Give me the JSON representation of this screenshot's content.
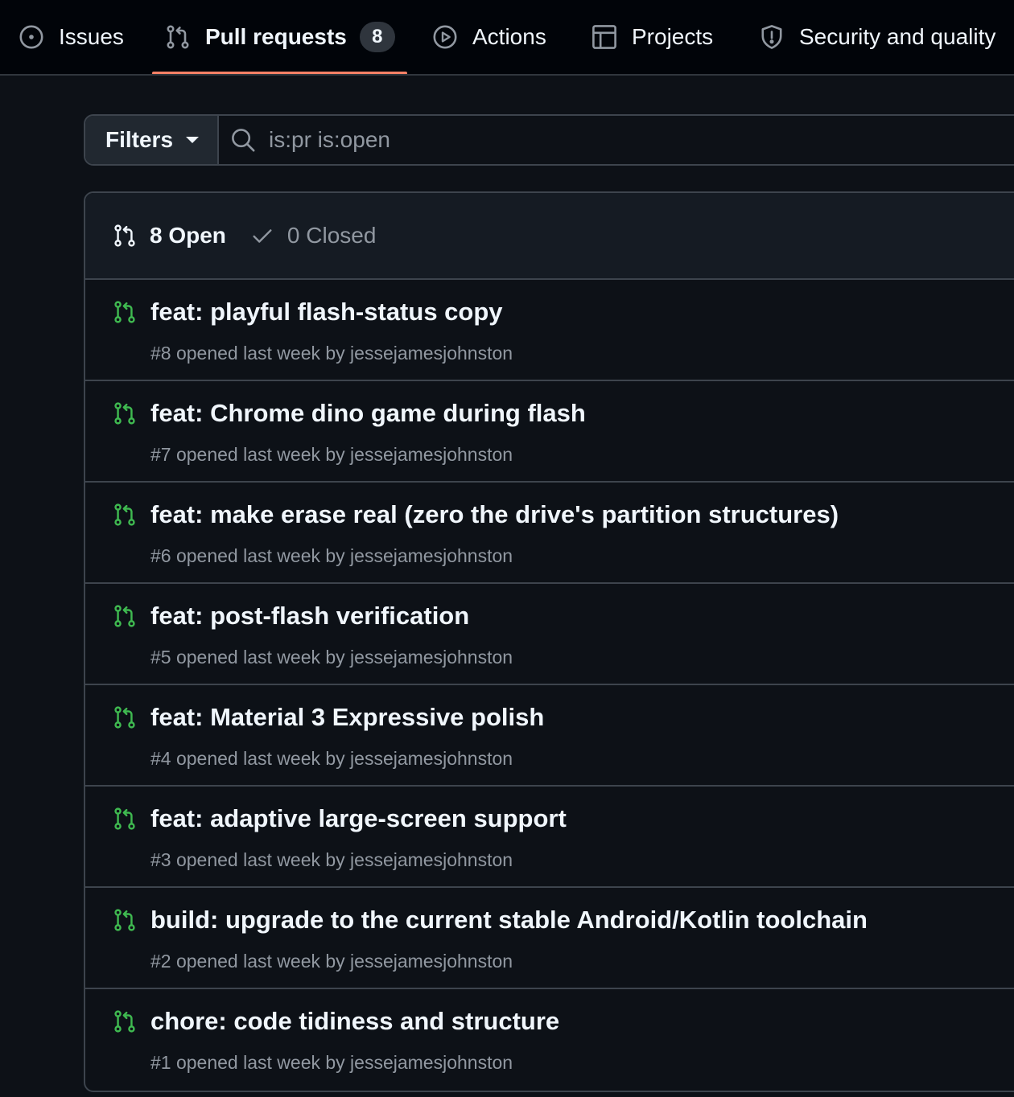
{
  "nav": {
    "tabs": [
      {
        "label": "Issues",
        "icon": "issue-opened-icon"
      },
      {
        "label": "Pull requests",
        "icon": "git-pull-request-icon",
        "counter": "8",
        "active": true
      },
      {
        "label": "Actions",
        "icon": "play-icon"
      },
      {
        "label": "Projects",
        "icon": "table-icon"
      },
      {
        "label": "Security and quality",
        "icon": "shield-icon"
      }
    ],
    "active_underline_color": "#f78166"
  },
  "filter_bar": {
    "filters_label": "Filters",
    "search_value": "is:pr is:open"
  },
  "pr_list": {
    "open_label": "8 Open",
    "closed_label": "0 Closed",
    "open_icon_color": "#3fb950",
    "items": [
      {
        "title": "feat: playful flash-status copy",
        "meta": "#8 opened last week by jessejamesjohnston"
      },
      {
        "title": "feat: Chrome dino game during flash",
        "meta": "#7 opened last week by jessejamesjohnston"
      },
      {
        "title": "feat: make erase real (zero the drive's partition structures)",
        "meta": "#6 opened last week by jessejamesjohnston"
      },
      {
        "title": "feat: post-flash verification",
        "meta": "#5 opened last week by jessejamesjohnston"
      },
      {
        "title": "feat: Material 3 Expressive polish",
        "meta": "#4 opened last week by jessejamesjohnston"
      },
      {
        "title": "feat: adaptive large-screen support",
        "meta": "#3 opened last week by jessejamesjohnston"
      },
      {
        "title": "build: upgrade to the current stable Android/Kotlin toolchain",
        "meta": "#2 opened last week by jessejamesjohnston"
      },
      {
        "title": "chore: code tidiness and structure",
        "meta": "#1 opened last week by jessejamesjohnston"
      }
    ]
  }
}
